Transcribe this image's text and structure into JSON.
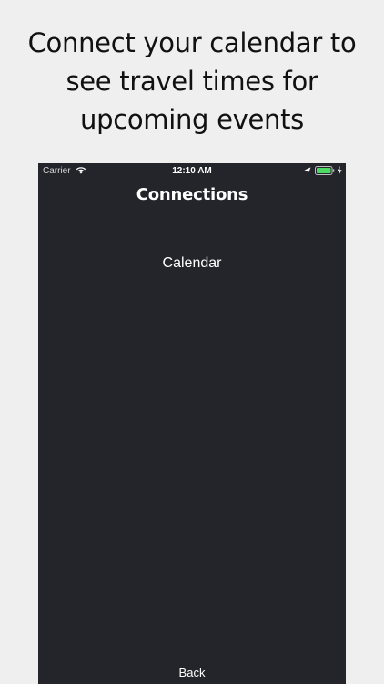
{
  "promo": {
    "headline_lines": [
      "Connect your calendar to",
      "see travel times for",
      "upcoming events"
    ]
  },
  "status_bar": {
    "carrier": "Carrier",
    "time": "12:10 AM",
    "battery_color": "#4cd964"
  },
  "screen": {
    "title": "Connections",
    "items": [
      {
        "label": "Calendar"
      }
    ],
    "back_label": "Back",
    "background": "#23252b"
  }
}
